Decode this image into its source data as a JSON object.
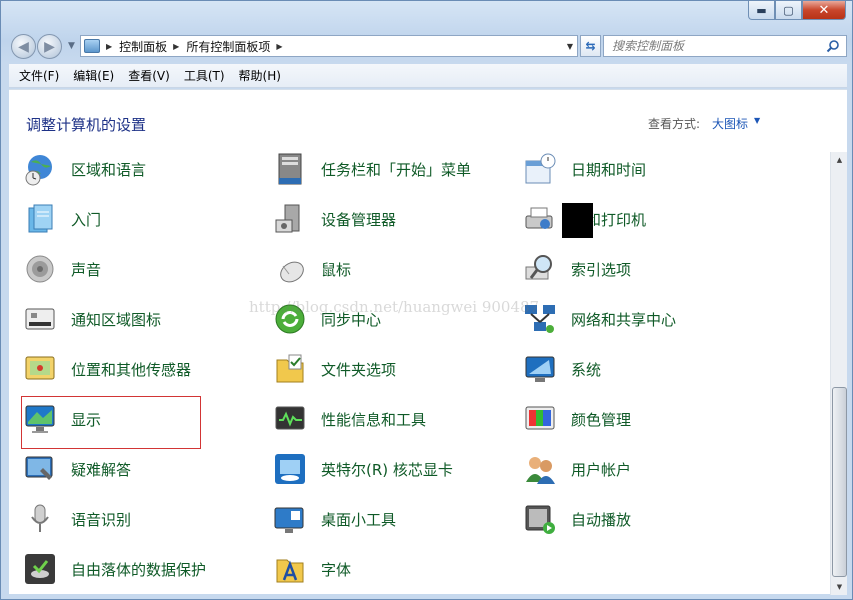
{
  "window": {
    "close_glyph": "✕",
    "minimize_glyph": "▬",
    "maximize_glyph": "▢"
  },
  "address": {
    "crumbs": [
      "控制面板",
      "所有控制面板项"
    ],
    "search_placeholder": "搜索控制面板"
  },
  "menu": [
    "文件(F)",
    "编辑(E)",
    "查看(V)",
    "工具(T)",
    "帮助(H)"
  ],
  "header": {
    "title": "调整计算机的设置",
    "view_by_label": "查看方式:",
    "view_by_value": "大图标"
  },
  "items": [
    {
      "label": "区域和语言",
      "icon": "globe-clock-icon"
    },
    {
      "label": "任务栏和「开始」菜单",
      "icon": "taskbar-icon"
    },
    {
      "label": "日期和时间",
      "icon": "calendar-clock-icon"
    },
    {
      "label": "入门",
      "icon": "getting-started-icon"
    },
    {
      "label": "设备管理器",
      "icon": "device-manager-icon"
    },
    {
      "label": "备和打印机",
      "icon": "printer-icon"
    },
    {
      "label": "声音",
      "icon": "speaker-icon"
    },
    {
      "label": "鼠标",
      "icon": "mouse-icon"
    },
    {
      "label": "索引选项",
      "icon": "magnifier-icon"
    },
    {
      "label": "通知区域图标",
      "icon": "notification-icon"
    },
    {
      "label": "同步中心",
      "icon": "sync-icon"
    },
    {
      "label": "网络和共享中心",
      "icon": "network-icon"
    },
    {
      "label": "位置和其他传感器",
      "icon": "location-sensor-icon"
    },
    {
      "label": "文件夹选项",
      "icon": "folder-options-icon"
    },
    {
      "label": "系统",
      "icon": "system-icon"
    },
    {
      "label": "显示",
      "icon": "display-icon"
    },
    {
      "label": "性能信息和工具",
      "icon": "performance-icon"
    },
    {
      "label": "颜色管理",
      "icon": "color-management-icon"
    },
    {
      "label": "疑难解答",
      "icon": "troubleshooting-icon"
    },
    {
      "label": "英特尔(R) 核芯显卡",
      "icon": "intel-graphics-icon"
    },
    {
      "label": "用户帐户",
      "icon": "user-accounts-icon"
    },
    {
      "label": "语音识别",
      "icon": "microphone-icon"
    },
    {
      "label": "桌面小工具",
      "icon": "gadgets-icon"
    },
    {
      "label": "自动播放",
      "icon": "autoplay-icon"
    },
    {
      "label": "自由落体的数据保护",
      "icon": "data-protection-icon"
    },
    {
      "label": "字体",
      "icon": "fonts-icon"
    }
  ],
  "watermark": "http://blog.csdn.net/huangwei 900487"
}
